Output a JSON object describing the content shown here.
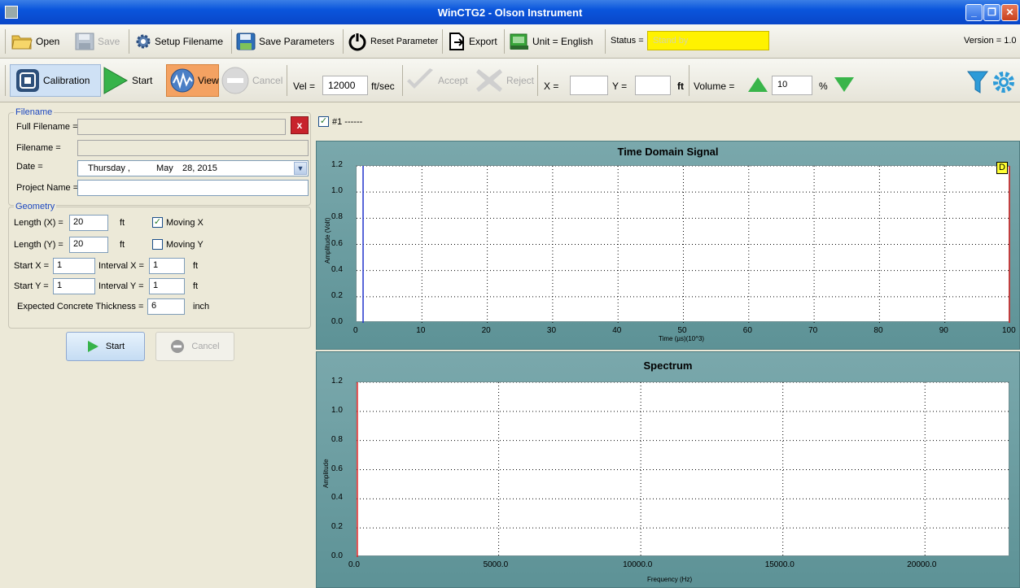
{
  "window": {
    "title": "WinCTG2 - Olson Instrument",
    "buttons": [
      "_",
      "❐",
      "✕"
    ]
  },
  "toolbar1": {
    "open": "Open",
    "save": "Save",
    "setup_filename": "Setup Filename",
    "save_parameters": "Save Parameters",
    "reset_parameter": "Reset Parameter",
    "export": "Export",
    "unit": "Unit = English",
    "status_label": "Status =",
    "status_value": "Stand by",
    "version": "Version = 1.0"
  },
  "toolbar2": {
    "calibration": "Calibration",
    "start": "Start",
    "view": "View",
    "cancel": "Cancel",
    "vel_label": "Vel =",
    "vel_value": "12000",
    "vel_unit": "ft/sec",
    "accept": "Accept",
    "reject": "Reject",
    "x_label": "X =",
    "x_value": "",
    "y_label": "Y =",
    "y_value": "",
    "xy_unit": "ft",
    "volume_label": "Volume =",
    "volume_value": "10",
    "volume_unit": "%"
  },
  "filename_group": {
    "legend": "Filename",
    "full_filename_label": "Full Filename =",
    "full_filename_value": "",
    "clear_button": "x",
    "filename_label": "Filename =",
    "filename_value": "",
    "date_label": "Date =",
    "date_day": "Thursday ,",
    "date_month": "May",
    "date_rest": "28, 2015",
    "project_label": "Project Name =",
    "project_value": ""
  },
  "geometry_group": {
    "legend": "Geometry",
    "length_x_label": "Length (X) =",
    "length_x_value": "20",
    "length_x_unit": "ft",
    "moving_x_label": "Moving X",
    "moving_x_checked": true,
    "length_y_label": "Length (Y) =",
    "length_y_value": "20",
    "length_y_unit": "ft",
    "moving_y_label": "Moving Y",
    "moving_y_checked": false,
    "start_x_label": "Start X =",
    "start_x_value": "1",
    "interval_x_label": "Interval X =",
    "interval_x_value": "1",
    "interval_x_unit": "ft",
    "start_y_label": "Start Y =",
    "start_y_value": "1",
    "interval_y_label": "Interval Y =",
    "interval_y_value": "1",
    "interval_y_unit": "ft",
    "thickness_label": "Expected Concrete Thickness =",
    "thickness_value": "6",
    "thickness_unit": "inch"
  },
  "actions": {
    "start": "Start",
    "cancel": "Cancel"
  },
  "series_toggle": {
    "label": "#1 ------",
    "checked": true
  },
  "chart_data": [
    {
      "type": "line",
      "title": "Time Domain Signal",
      "xlabel": "Time (µs)(10^3)",
      "ylabel": "Amplitude (Volt)",
      "xlim": [
        0,
        100
      ],
      "ylim": [
        0,
        1.2
      ],
      "x_ticks": [
        "0",
        "10",
        "20",
        "30",
        "40",
        "50",
        "60",
        "70",
        "80",
        "90",
        "100"
      ],
      "y_ticks": [
        "0.0",
        "0.2",
        "0.4",
        "0.6",
        "0.8",
        "1.0",
        "1.2"
      ],
      "grid": true,
      "marker_label": "D",
      "cursors": [
        {
          "x": 1,
          "color": "#2233cc"
        },
        {
          "x": 100,
          "color": "#dd2222"
        }
      ],
      "series": []
    },
    {
      "type": "line",
      "title": "Spectrum",
      "xlabel": "Frequency (Hz)",
      "ylabel": "Amplitude",
      "xlim": [
        0,
        23000
      ],
      "ylim": [
        0,
        1.2
      ],
      "x_ticks": [
        "0.0",
        "5000.0",
        "10000.0",
        "15000.0",
        "20000.0"
      ],
      "x_tick_values": [
        0,
        5000,
        10000,
        15000,
        20000
      ],
      "y_ticks": [
        "0.0",
        "0.2",
        "0.4",
        "0.6",
        "0.8",
        "1.0",
        "1.2"
      ],
      "grid": true,
      "cursors": [
        {
          "x": 0,
          "color": "#dd2222"
        }
      ],
      "series": []
    }
  ]
}
